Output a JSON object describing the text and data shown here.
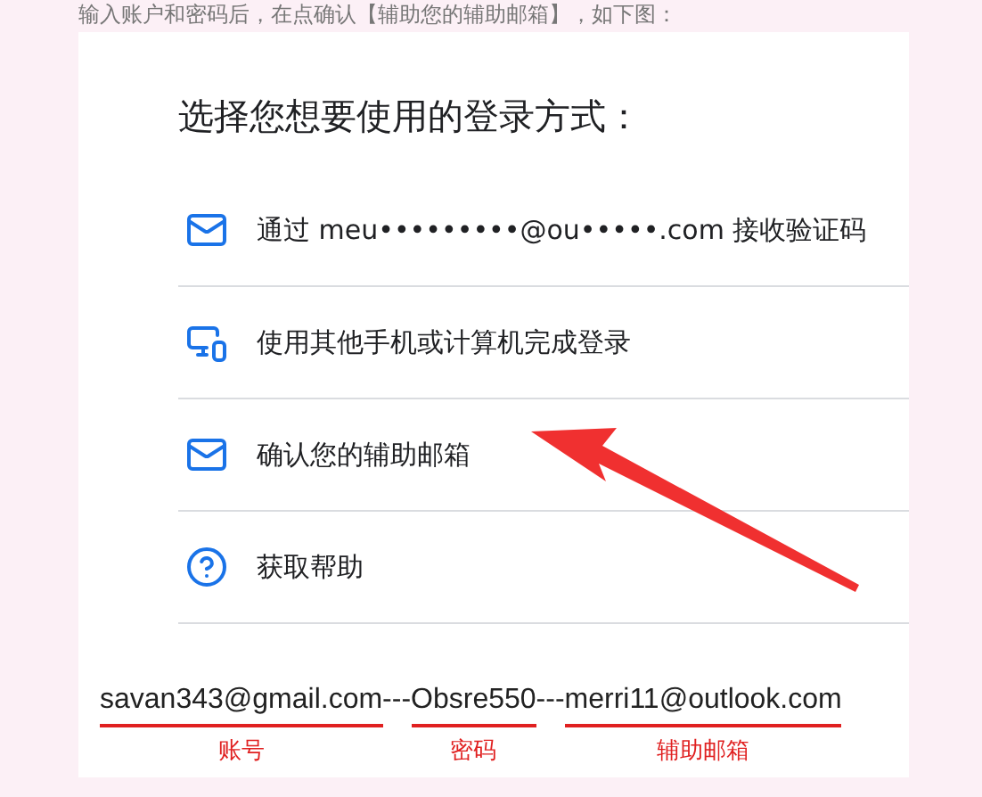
{
  "caption": "输入账户和密码后，在点确认【辅助您的辅助邮箱】，如下图：",
  "title": "选择您想要使用的登录方式：",
  "options": [
    {
      "kind": "mail",
      "label": "通过 meu•••••••••@ou•••••.com 接收验证码"
    },
    {
      "kind": "devices",
      "label": "使用其他手机或计算机完成登录"
    },
    {
      "kind": "mail",
      "label": "确认您的辅助邮箱"
    },
    {
      "kind": "help",
      "label": "获取帮助"
    }
  ],
  "credentials": [
    {
      "kind": "field",
      "value": "savan343@gmail.com",
      "label": "账号"
    },
    {
      "kind": "separator",
      "value": "---"
    },
    {
      "kind": "field",
      "value": "Obsre550",
      "label": "密码"
    },
    {
      "kind": "separator",
      "value": "---"
    },
    {
      "kind": "field",
      "value": "merri11@outlook.com",
      "label": "辅助邮箱"
    }
  ]
}
